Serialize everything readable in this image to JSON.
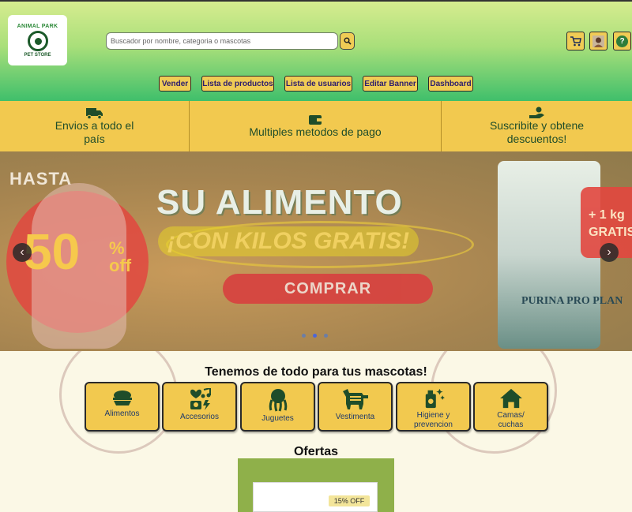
{
  "header": {
    "logo": {
      "top_text": "ANIMAL PARK",
      "bottom_text": "PET STORE"
    },
    "search": {
      "placeholder": "Buscador por nombre, categoria o mascotas"
    },
    "icons": [
      "cart-icon",
      "user-avatar-icon",
      "help-icon"
    ],
    "help_label": "?",
    "nav": [
      "Vender",
      "Lista de productos",
      "Lista de usuarios",
      "Editar Banner",
      "Dashboard"
    ]
  },
  "infobar": [
    {
      "icon": "delivery-truck-icon",
      "text": "Envios a todo el país"
    },
    {
      "icon": "wallet-icon",
      "text": "Multiples metodos de pago"
    },
    {
      "icon": "hand-coin-icon",
      "text": "Suscribite y obtene descuentos!"
    }
  ],
  "carousel": {
    "hasta": "HASTA",
    "percent": "50",
    "pct_sign": "%",
    "off": "off",
    "title": "SU ALIMENTO",
    "subtitle": "¡CON KILOS GRATIS!",
    "button": "COMPRAR",
    "brand": "PURINA PRO PLAN",
    "extra_kg": "+ 1 kg",
    "extra_free": "GRATIS",
    "prev": "‹",
    "next": "›",
    "slide_count": 3,
    "active_slide": 1
  },
  "categories": {
    "title": "Tenemos de todo para tus mascotas!",
    "items": [
      {
        "label": "Alimentos",
        "icon": "food-bowl-icon"
      },
      {
        "label": "Accesorios",
        "icon": "accessories-icon"
      },
      {
        "label": "Juguetes",
        "icon": "octopus-toy-icon"
      },
      {
        "label": "Vestimenta",
        "icon": "dog-clothes-icon"
      },
      {
        "label": "Higiene y prevencion",
        "icon": "hygiene-spray-icon"
      },
      {
        "label": "Camas/ cuchas",
        "icon": "house-icon"
      }
    ]
  },
  "offers": {
    "title": "Ofertas",
    "badge": "15% OFF"
  },
  "colors": {
    "yellow": "#f2c94f",
    "green_dark": "#1f4d2a",
    "nav_text": "#2c1d6e",
    "category_text": "#1f3a6a"
  }
}
